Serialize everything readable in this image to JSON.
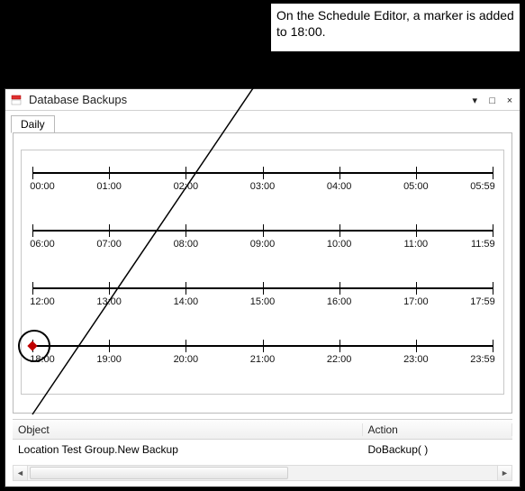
{
  "callout": {
    "text": "On the Schedule Editor, a marker is added to 18:00."
  },
  "window": {
    "title": "Database Backups"
  },
  "tab": {
    "label": "Daily"
  },
  "timeline": {
    "rows": [
      {
        "labels": [
          "00:00",
          "01:00",
          "02:00",
          "03:00",
          "04:00",
          "05:00",
          "05:59"
        ]
      },
      {
        "labels": [
          "06:00",
          "07:00",
          "08:00",
          "09:00",
          "10:00",
          "11:00",
          "11:59"
        ]
      },
      {
        "labels": [
          "12:00",
          "13:00",
          "14:00",
          "15:00",
          "16:00",
          "17:00",
          "17:59"
        ]
      },
      {
        "labels": [
          "18:00",
          "19:00",
          "20:00",
          "21:00",
          "22:00",
          "23:00",
          "23:59"
        ]
      }
    ],
    "marker": {
      "row": 3,
      "time": "18:00"
    }
  },
  "table": {
    "headers": {
      "object": "Object",
      "action": "Action"
    },
    "rows": [
      {
        "object": "Location Test Group.New Backup",
        "action": "DoBackup( )"
      }
    ]
  },
  "icons": {
    "minimize": "▾",
    "maximize": "□",
    "close": "×",
    "scroll_left": "◄",
    "scroll_right": "►"
  }
}
